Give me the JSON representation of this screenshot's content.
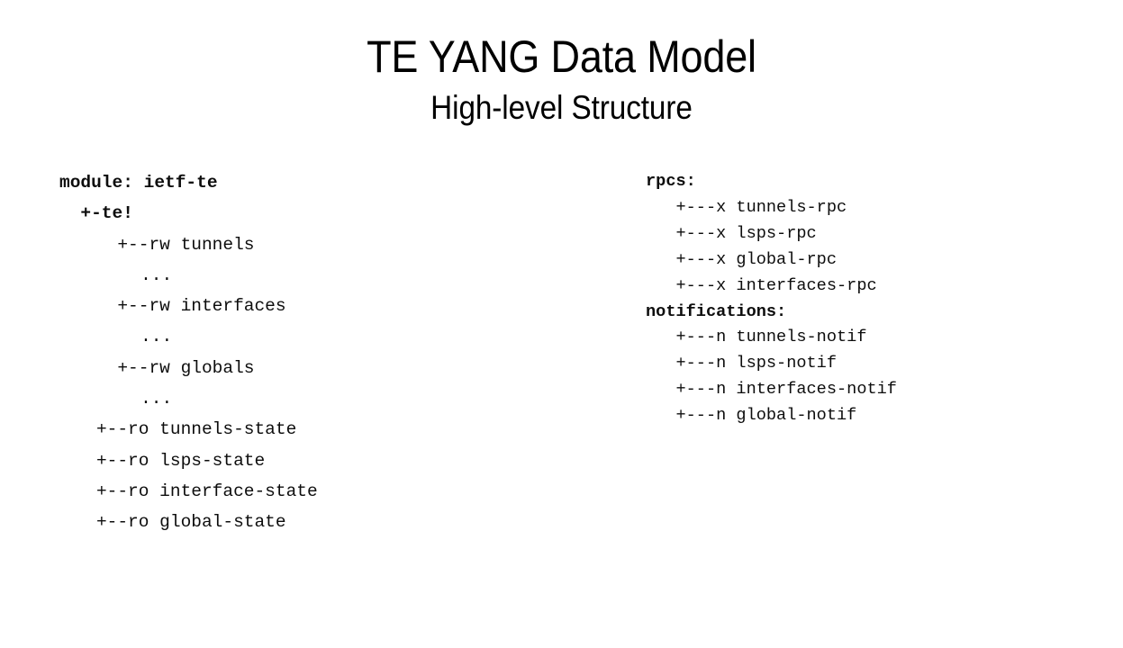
{
  "slide": {
    "title": "TE YANG Data Model",
    "subtitle": "High-level Structure",
    "background_color": "#ffffff",
    "text_color": "#000000"
  },
  "left_column": {
    "name": "module-tree",
    "lines": [
      {
        "text": "module: ietf-te",
        "indent_ch": 0.0,
        "bold": true,
        "name": "module-declaration"
      },
      {
        "text": "+-te!",
        "indent_ch": 2.0,
        "bold": true,
        "name": "tree-node-te"
      },
      {
        "text": "+--rw tunnels",
        "indent_ch": 5.5,
        "bold": false,
        "name": "tree-node-tunnels"
      },
      {
        "text": "...",
        "indent_ch": 7.7,
        "bold": false,
        "name": "tree-ellipsis-tunnels"
      },
      {
        "text": "+--rw interfaces",
        "indent_ch": 5.5,
        "bold": false,
        "name": "tree-node-interfaces"
      },
      {
        "text": "...",
        "indent_ch": 7.7,
        "bold": false,
        "name": "tree-ellipsis-interfaces"
      },
      {
        "text": "+--rw globals",
        "indent_ch": 5.5,
        "bold": false,
        "name": "tree-node-globals"
      },
      {
        "text": "...",
        "indent_ch": 7.7,
        "bold": false,
        "name": "tree-ellipsis-globals"
      },
      {
        "text": "+--ro tunnels-state",
        "indent_ch": 3.5,
        "bold": false,
        "name": "tree-node-tunnels-state"
      },
      {
        "text": "+--ro lsps-state",
        "indent_ch": 3.5,
        "bold": false,
        "name": "tree-node-lsps-state"
      },
      {
        "text": "+--ro interface-state",
        "indent_ch": 3.5,
        "bold": false,
        "name": "tree-node-interface-state"
      },
      {
        "text": "+--ro global-state",
        "indent_ch": 3.5,
        "bold": false,
        "name": "tree-node-global-state"
      }
    ]
  },
  "right_column": {
    "name": "rpcs-and-notifications-tree",
    "lines": [
      {
        "text": "rpcs:",
        "indent_ch": 0.0,
        "bold": true,
        "name": "rpcs-heading"
      },
      {
        "text": "+---x tunnels-rpc",
        "indent_ch": 3.0,
        "bold": false,
        "name": "rpc-node-tunnels-rpc"
      },
      {
        "text": "+---x lsps-rpc",
        "indent_ch": 3.0,
        "bold": false,
        "name": "rpc-node-lsps-rpc"
      },
      {
        "text": "+---x global-rpc",
        "indent_ch": 3.0,
        "bold": false,
        "name": "rpc-node-global-rpc"
      },
      {
        "text": "+---x interfaces-rpc",
        "indent_ch": 3.0,
        "bold": false,
        "name": "rpc-node-interfaces-rpc"
      },
      {
        "text": "notifications:",
        "indent_ch": 0.0,
        "bold": true,
        "name": "notifications-heading"
      },
      {
        "text": "+---n tunnels-notif",
        "indent_ch": 3.0,
        "bold": false,
        "name": "notif-node-tunnels-notif"
      },
      {
        "text": "+---n lsps-notif",
        "indent_ch": 3.0,
        "bold": false,
        "name": "notif-node-lsps-notif"
      },
      {
        "text": "+---n interfaces-notif",
        "indent_ch": 3.0,
        "bold": false,
        "name": "notif-node-interfaces-notif"
      },
      {
        "text": "+---n global-notif",
        "indent_ch": 3.0,
        "bold": false,
        "name": "notif-node-global-notif"
      }
    ]
  }
}
